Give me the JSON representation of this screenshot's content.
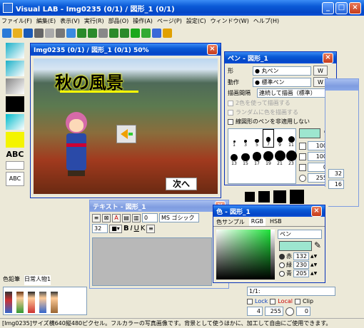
{
  "app": {
    "title": "Visual LAB - Img0235 (0/1) / 図形_1 (0/1)"
  },
  "menu": [
    "ファイル(F)",
    "編集(E)",
    "表示(V)",
    "実行(R)",
    "部品(O)",
    "操作(A)",
    "ページ(P)",
    "設定(C)",
    "ウィンドウ(W)",
    "ヘルプ(H)"
  ],
  "toolbar_icons": [
    "new-icon",
    "open-icon",
    "save-icon",
    "print-icon",
    "cut-icon",
    "copy-icon",
    "paste-icon",
    "undo-icon",
    "redo-icon",
    "trash-icon",
    "zoom-in-icon",
    "zoom-out-icon",
    "play-icon",
    "grid-icon",
    "page-icon",
    "help-icon"
  ],
  "palette_labels": {
    "abc1": "ABC",
    "abc2": "ABC"
  },
  "canvas": {
    "title": "Img0235 (0/1) / 図形_1 (0/1) 50%",
    "heading": "秋の風景",
    "next_button": "次へ"
  },
  "pen": {
    "title": "ペン - 図形_1",
    "shape_label": "形",
    "shape_value": "● 丸ペン",
    "action_label": "動作",
    "action_value": "● 標準ペン",
    "interval_label": "描画間隔",
    "interval_value": "連続して描画（標準）",
    "opt1": "2色を使って描画する",
    "opt2": "ランダムに色を描画する",
    "opt3": "線図形のペンを非適用しない",
    "sizes": [
      "1",
      "3",
      "5",
      "7",
      "9",
      "11",
      "13",
      "15",
      "17",
      "19",
      "21",
      "23"
    ],
    "num1": "100",
    "num2": "100",
    "num3": "0",
    "num4": "255"
  },
  "text": {
    "title": "テキスト - 図形_1",
    "font_name": "MS ゴシック",
    "font_size": "32",
    "size_num": "0",
    "bold": "B",
    "italic": "I",
    "underline": "U",
    "strike": "K"
  },
  "color": {
    "title": "色 - 図形_1",
    "tabs": [
      "色サンプル",
      "RGB",
      "HSB"
    ],
    "target": "ペン",
    "red_label": "赤",
    "green_label": "緑",
    "blue_label": "青",
    "red": "132",
    "green": "230",
    "blue": "205",
    "swatch": "#9de6cf"
  },
  "bottom_tabs": [
    "色鉛筆",
    "日常人物1"
  ],
  "right_panel": {
    "n1": "32",
    "n2": "16",
    "n3": "4",
    "n4": "255",
    "n5": "0",
    "lock": "Lock",
    "local": "Local",
    "clip": "Clip",
    "page": "1/1:"
  },
  "status": "[Img0235]サイズ横640縦480ピクセル。フルカラーの写真画像です。背景として使うほかに、加工して自由にご使用できます。"
}
